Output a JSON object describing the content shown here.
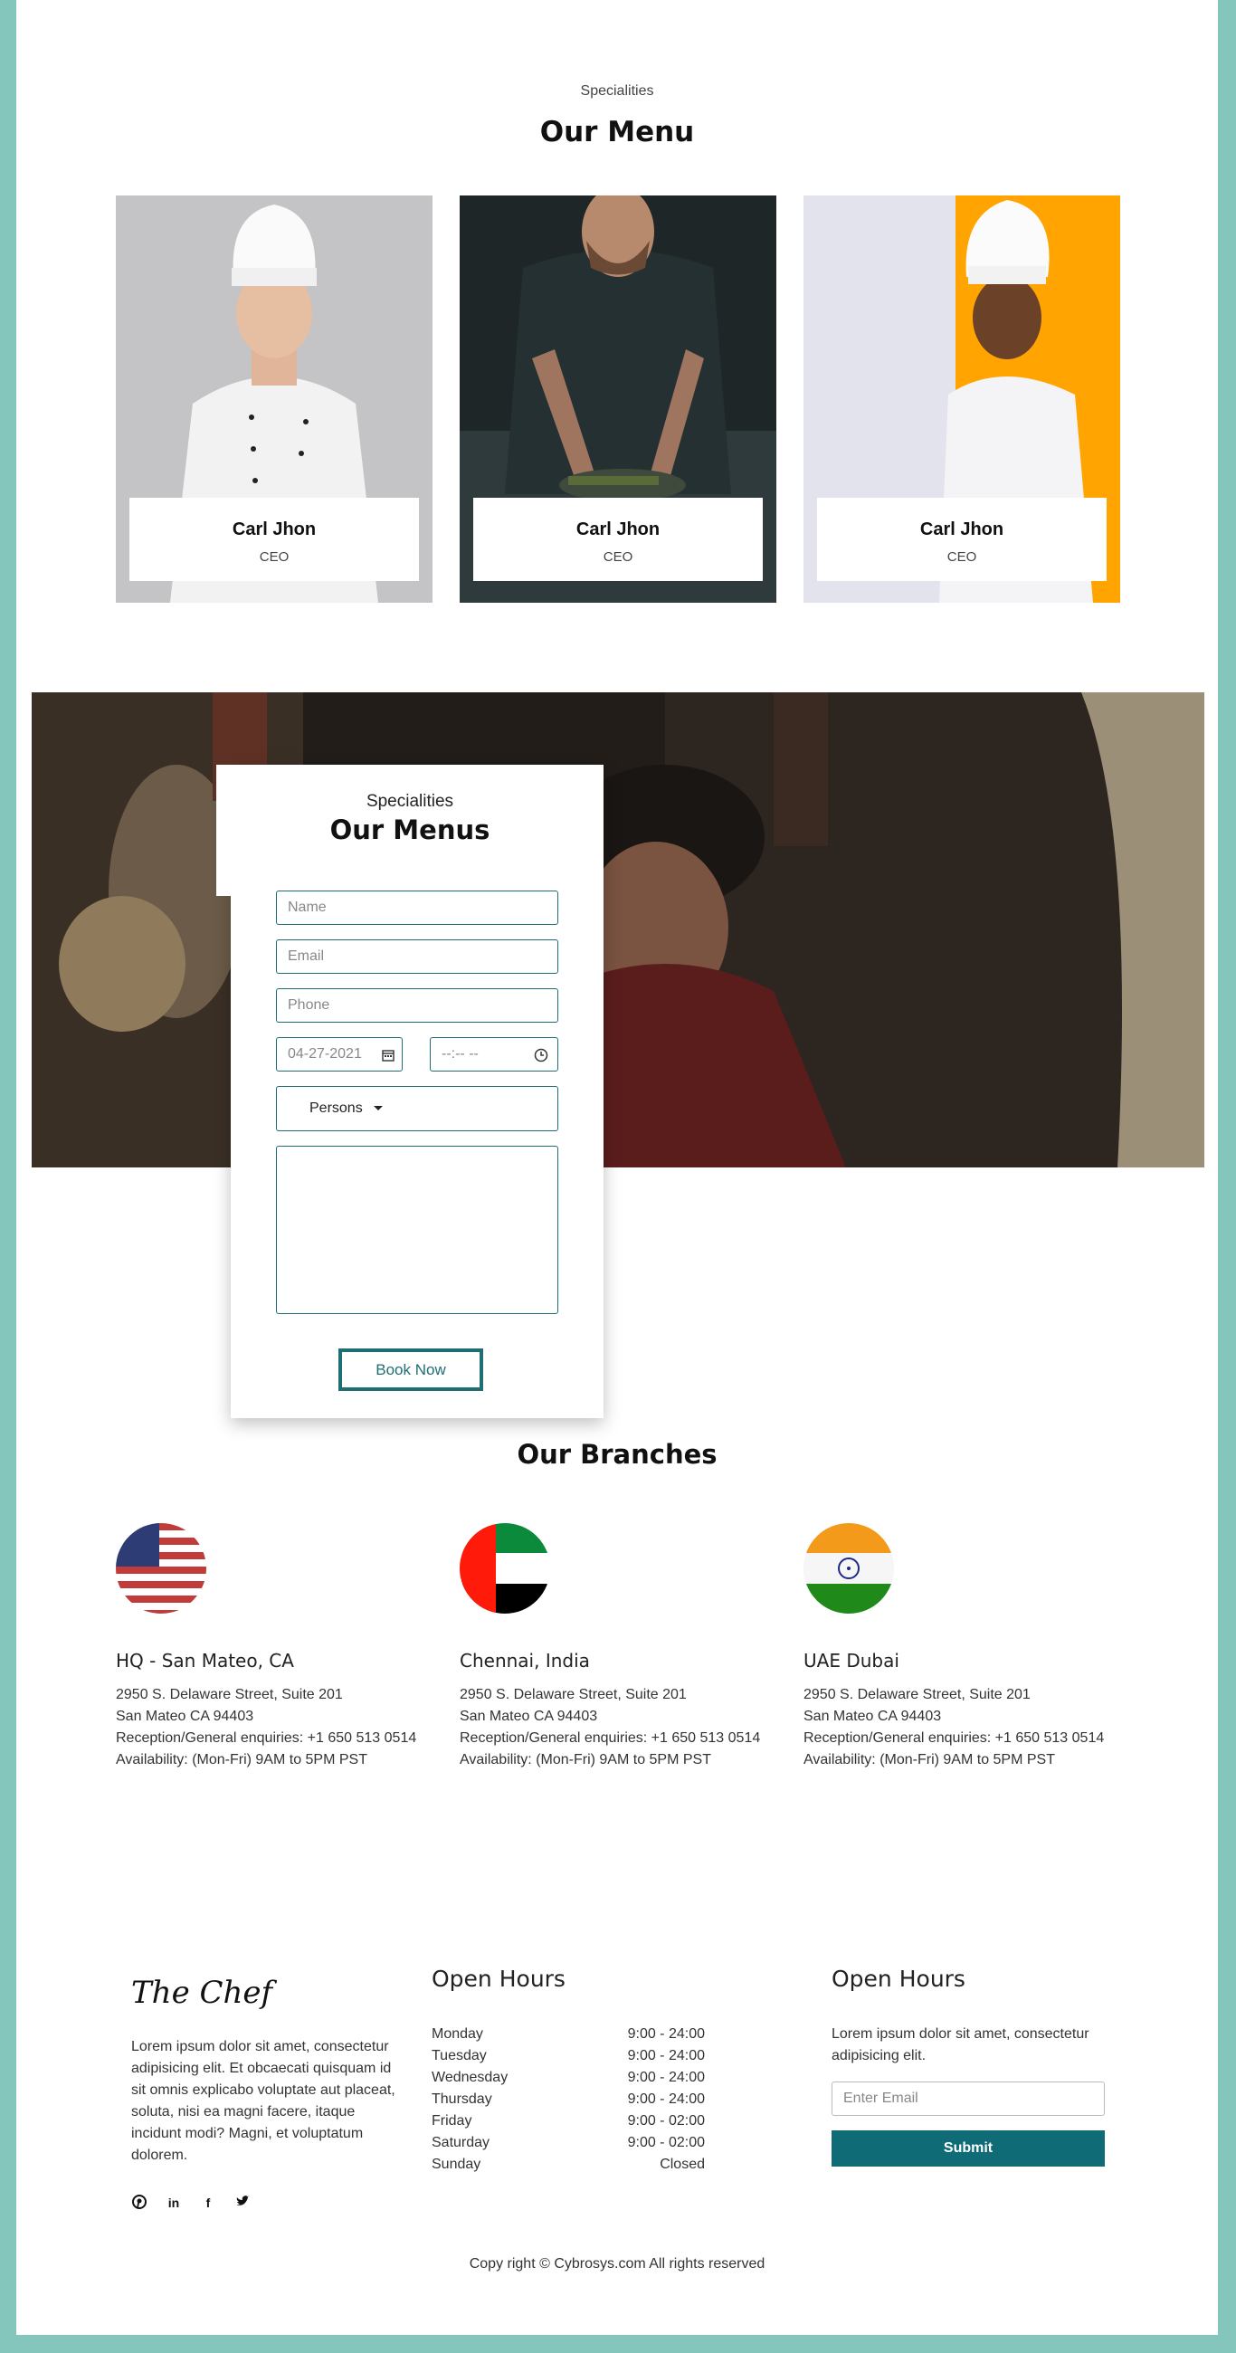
{
  "menu": {
    "kicker": "Specialities",
    "title": "Our Menu",
    "cards": [
      {
        "name": "Carl Jhon",
        "role": "CEO"
      },
      {
        "name": "Carl Jhon",
        "role": "CEO"
      },
      {
        "name": "Carl Jhon",
        "role": "CEO"
      }
    ]
  },
  "reservation": {
    "kicker": "Specialities",
    "title": "Our Menus",
    "name_placeholder": "Name",
    "email_placeholder": "Email",
    "phone_placeholder": "Phone",
    "date_value": "04-27-2021",
    "time_value": "--:-- --",
    "persons_label": "Persons",
    "book_label": "Book Now"
  },
  "branches": {
    "title": "Our Branches",
    "items": [
      {
        "name": "HQ - San Mateo, CA",
        "street": "2950 S. Delaware Street, Suite 201",
        "city": "San Mateo CA 94403",
        "phone": "Reception/General enquiries: +1 650 513 0514",
        "hours": "Availability: (Mon-Fri) 9AM to 5PM PST",
        "flag": "usa-flag"
      },
      {
        "name": "Chennai, India",
        "street": "2950 S. Delaware Street, Suite 201",
        "city": "San Mateo CA 94403",
        "phone": "Reception/General enquiries: +1 650 513 0514",
        "hours": "Availability: (Mon-Fri) 9AM to 5PM PST",
        "flag": "uae-flag"
      },
      {
        "name": "UAE Dubai",
        "street": "2950 S. Delaware Street, Suite 201",
        "city": "San Mateo CA 94403",
        "phone": "Reception/General enquiries: +1 650 513 0514",
        "hours": "Availability: (Mon-Fri) 9AM to 5PM PST",
        "flag": "india-flag"
      }
    ]
  },
  "footer": {
    "brand": "The Chef",
    "about": "Lorem ipsum dolor sit amet, consectetur adipisicing elit. Et obcaecati quisquam id sit omnis explicabo voluptate aut placeat, soluta, nisi ea magni facere, itaque incidunt modi? Magni, et voluptatum dolorem.",
    "social_icons": [
      "pinterest-icon",
      "linkedin-icon",
      "facebook-icon",
      "twitter-icon"
    ],
    "hours_title": "Open Hours",
    "hours": [
      {
        "day": "Monday",
        "time": "9:00 - 24:00"
      },
      {
        "day": "Tuesday",
        "time": "9:00 - 24:00"
      },
      {
        "day": "Wednesday",
        "time": "9:00 - 24:00"
      },
      {
        "day": "Thursday",
        "time": "9:00 - 24:00"
      },
      {
        "day": "Friday",
        "time": "9:00 - 02:00"
      },
      {
        "day": "Saturday",
        "time": "9:00 - 02:00"
      },
      {
        "day": "Sunday",
        "time": "Closed"
      }
    ],
    "news_title": "Open Hours",
    "news_text": "Lorem ipsum dolor sit amet, consectetur adipisicing elit.",
    "email_placeholder": "Enter Email",
    "submit_label": "Submit",
    "copyright": "Copy right © Cybrosys.com All rights reserved"
  },
  "colors": {
    "frame": "#84c5bc",
    "accent": "#1f6e73",
    "submit": "#0f6b75"
  }
}
